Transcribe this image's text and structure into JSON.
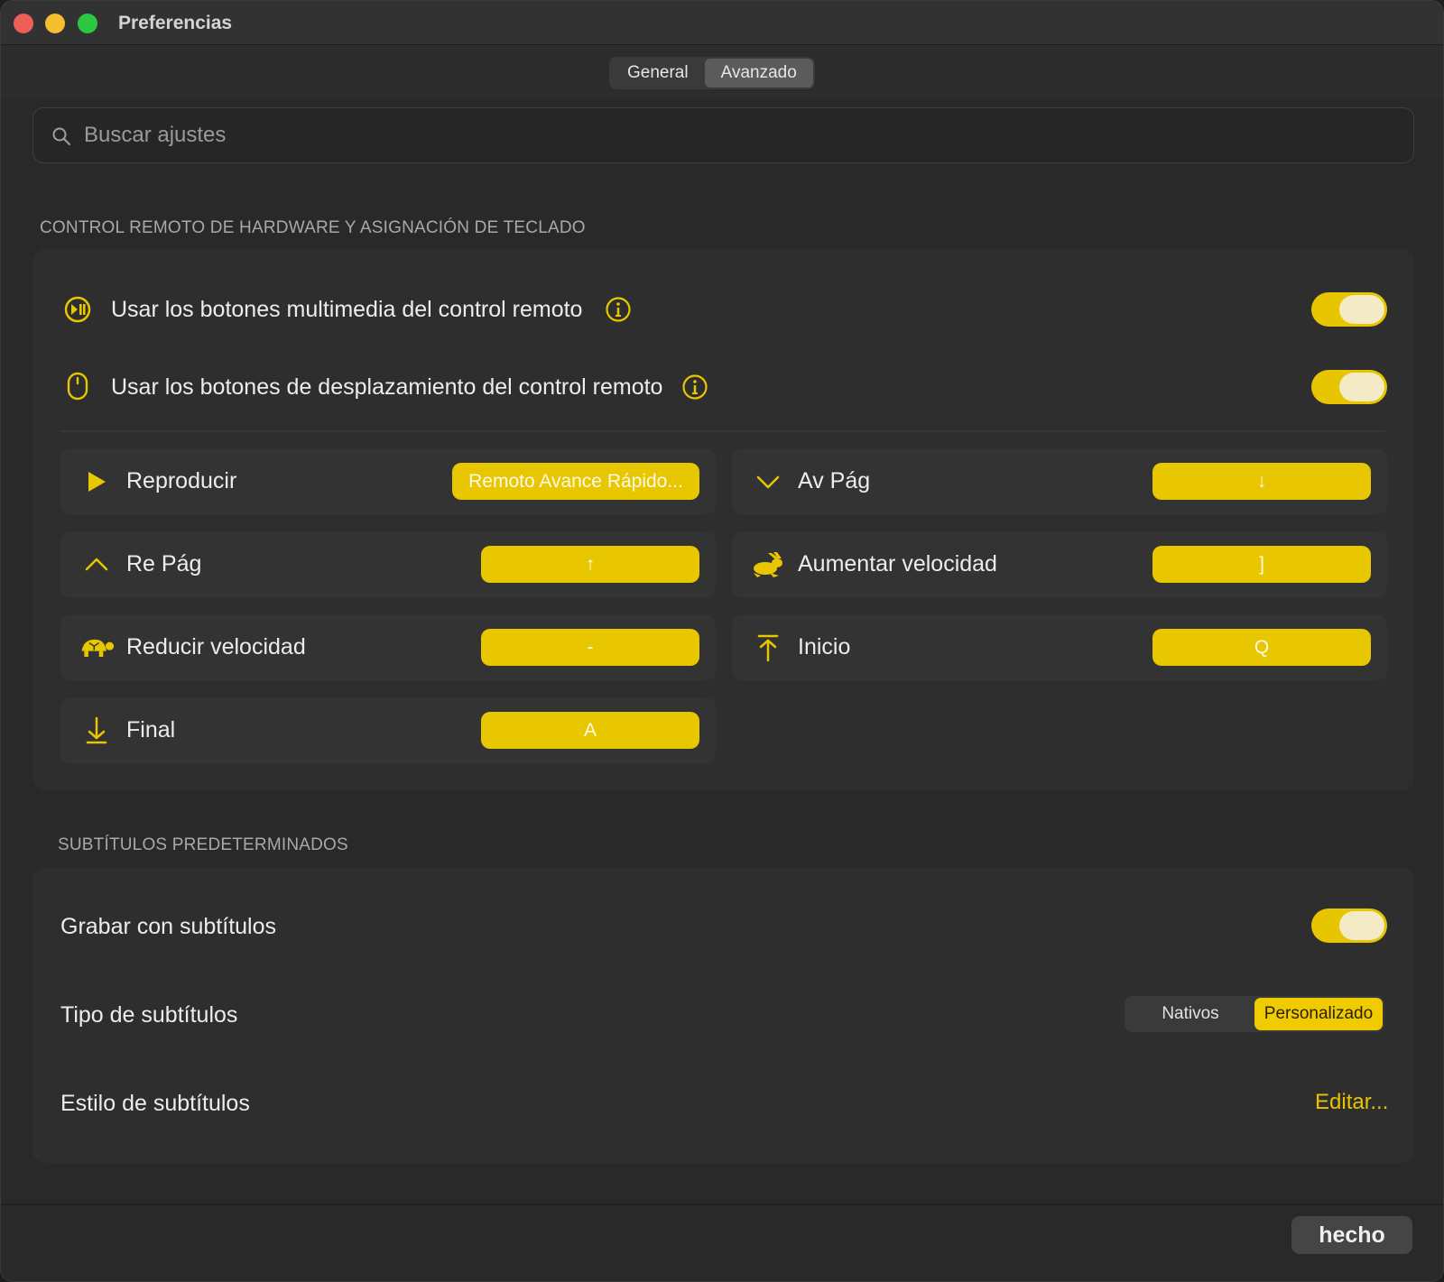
{
  "window": {
    "title": "Preferencias"
  },
  "tabs": [
    {
      "label": "General",
      "active": false
    },
    {
      "label": "Avanzado",
      "active": true
    }
  ],
  "search": {
    "placeholder": "Buscar ajustes",
    "value": ""
  },
  "section_remote": {
    "heading": "CONTROL REMOTO DE HARDWARE Y ASIGNACIÓN DE TECLADO",
    "toggles": [
      {
        "label": "Usar los botones multimedia del control remoto",
        "icon": "play-pause-circle-icon",
        "on": true
      },
      {
        "label": "Usar los botones de desplazamiento del control remoto",
        "icon": "mouse-icon",
        "on": true
      }
    ],
    "mappings": [
      {
        "label": "Reproducir",
        "icon": "play-icon",
        "key": "Remoto Avance Rápido..."
      },
      {
        "label": "Av Pág",
        "icon": "chevron-down-icon",
        "key": "↓"
      },
      {
        "label": "Re Pág",
        "icon": "chevron-up-icon",
        "key": "↑"
      },
      {
        "label": "Aumentar velocidad",
        "icon": "hare-icon",
        "key": "]"
      },
      {
        "label": "Reducir velocidad",
        "icon": "tortoise-icon",
        "key": "-"
      },
      {
        "label": "Inicio",
        "icon": "arrow-up-to-line-icon",
        "key": "Q"
      },
      {
        "label": "Final",
        "icon": "arrow-down-to-line-icon",
        "key": "A"
      }
    ]
  },
  "section_subtitles": {
    "heading": "SUBTÍTULOS PREDETERMINADOS",
    "record_label": "Grabar con subtítulos",
    "record_on": true,
    "type_label": "Tipo de subtítulos",
    "type_options": [
      {
        "label": "Nativos",
        "selected": false
      },
      {
        "label": "Personalizado",
        "selected": true
      }
    ],
    "style_label": "Estilo de subtítulos",
    "style_action": "Editar..."
  },
  "footer": {
    "done_label": "hecho"
  },
  "colors": {
    "accent": "#e8c700",
    "background": "#29292a",
    "panel": "#2e2e2f"
  }
}
